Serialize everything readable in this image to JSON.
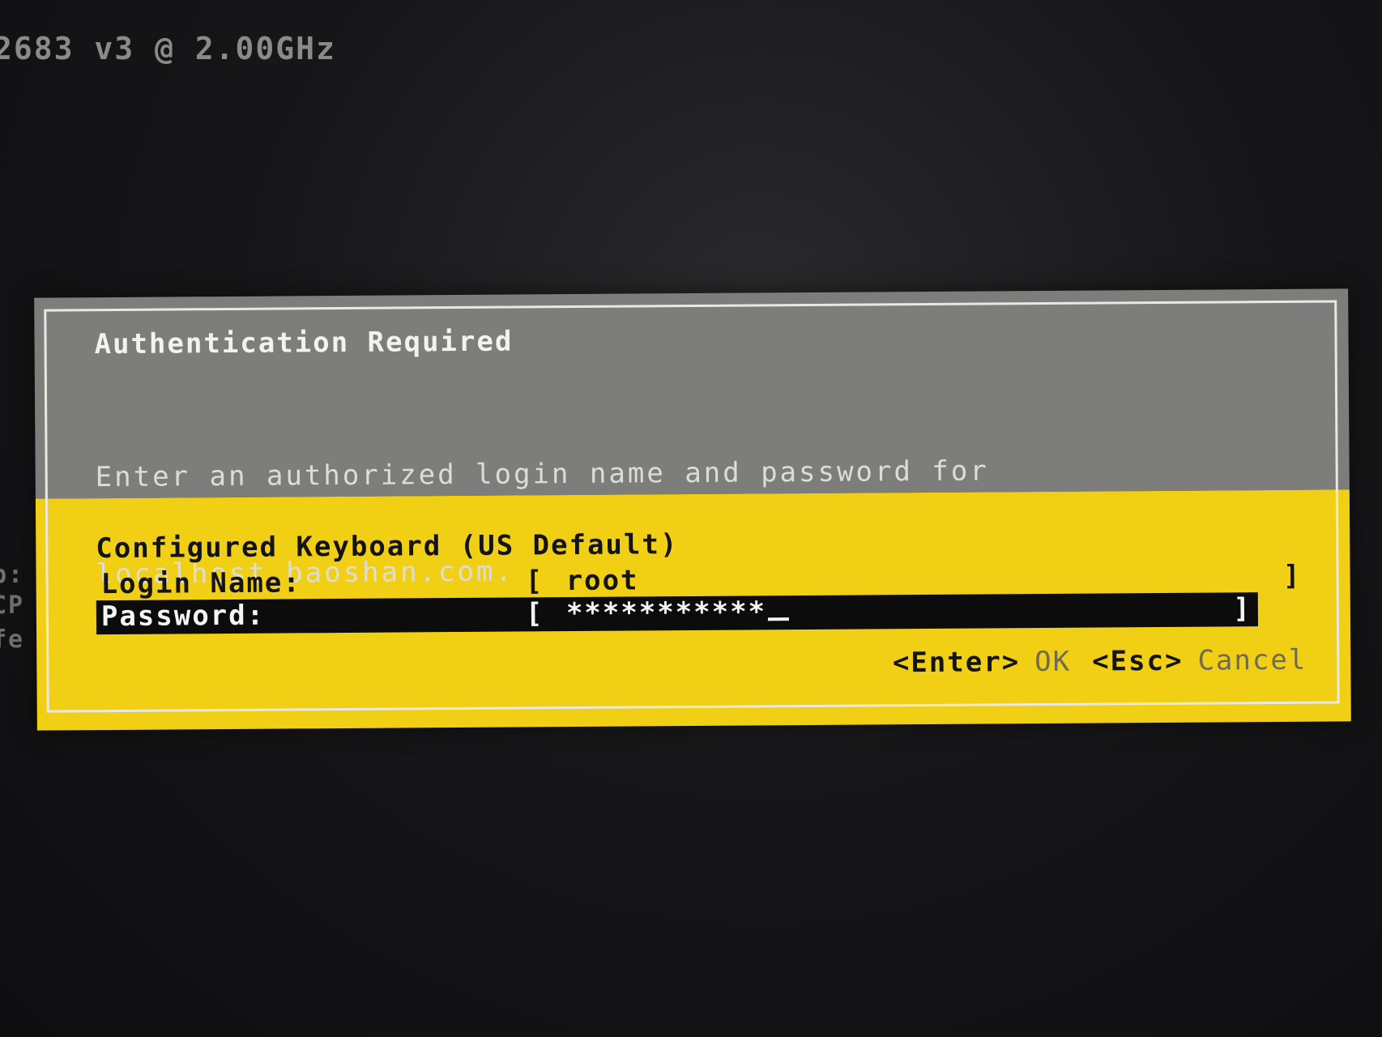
{
  "console": {
    "cpu_line": "2683 v3 @ 2.00GHz",
    "edge_fragments": [
      "p:",
      "CP",
      "fe"
    ]
  },
  "dialog": {
    "title": "Authentication Required",
    "message_line1": "Enter an authorized login name and password for",
    "message_line2": "localhost.baoshan.com.",
    "keyboard_line": "Configured Keyboard (US Default)",
    "login": {
      "label": "Login Name:",
      "open_bracket": "[",
      "value": "root",
      "close_bracket": "]"
    },
    "password": {
      "label": "Password:",
      "open_bracket": "[",
      "masked_value": "***********",
      "close_bracket": "]"
    },
    "actions": {
      "ok_key": "<Enter>",
      "ok_label": "OK",
      "cancel_key": "<Esc>",
      "cancel_label": "Cancel"
    }
  },
  "colors": {
    "header_gray": "#7d7d7b",
    "body_yellow": "#f1cf14",
    "selected_row_black": "#0c0c0c",
    "border_white": "#e9e9e2"
  }
}
